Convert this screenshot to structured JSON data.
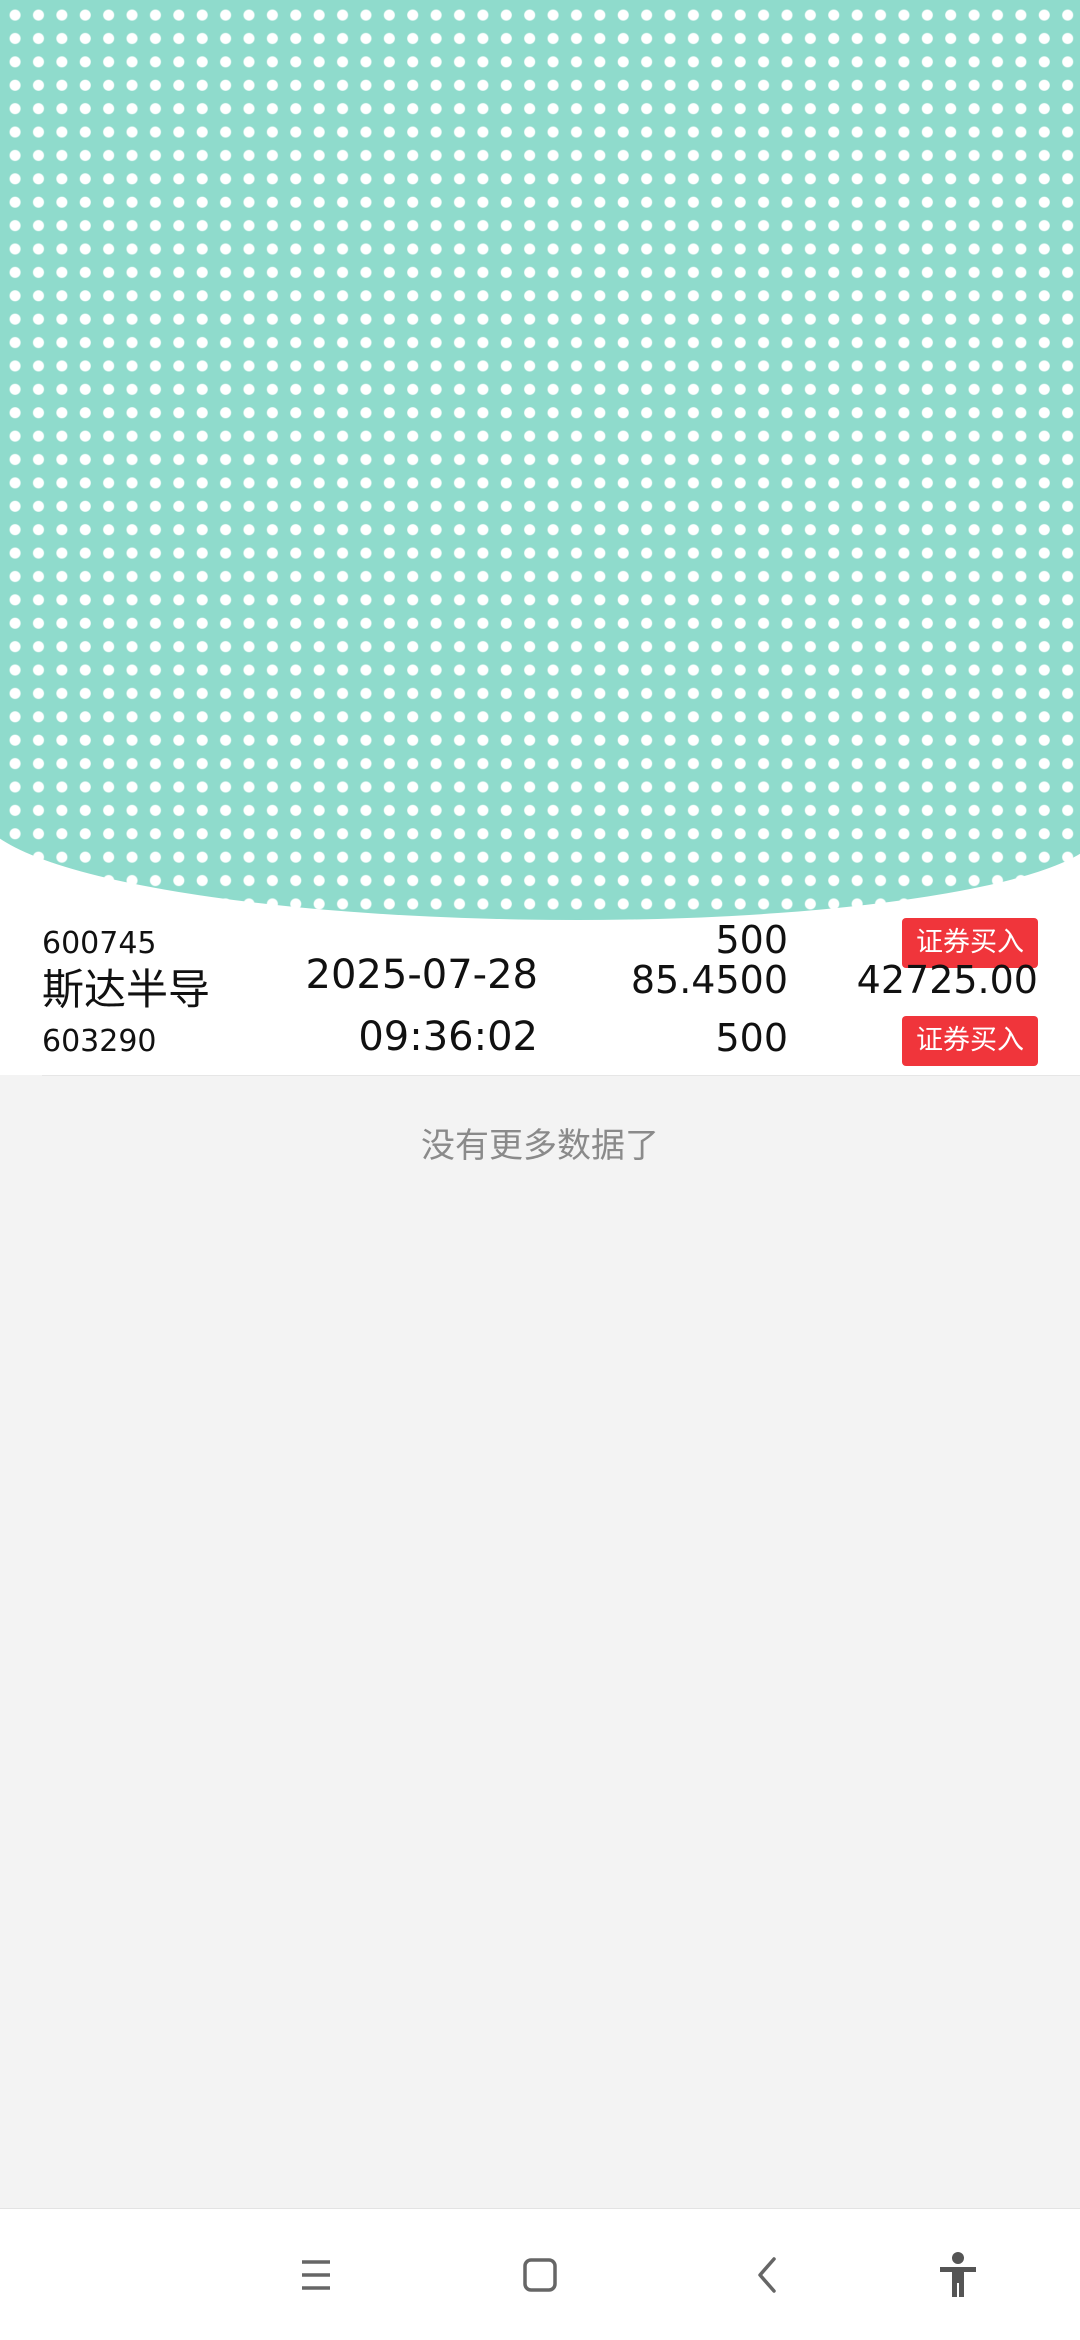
{
  "rows": [
    {
      "name": "",
      "code": "600745",
      "date": "",
      "time": "",
      "price": "",
      "qty": "500",
      "amount": "",
      "tag": "证券买入"
    },
    {
      "name": "斯达半导",
      "code": "603290",
      "date": "2025-07-28",
      "time": "09:36:02",
      "price": "85.4500",
      "qty": "500",
      "amount": "42725.00",
      "tag": "证券买入"
    }
  ],
  "footer": {
    "no_more": "没有更多数据了"
  },
  "navbar": {
    "icons": [
      "menu-icon",
      "home-icon",
      "back-icon",
      "accessibility-icon"
    ]
  },
  "colors": {
    "overlay": "#8fdbcc",
    "tag": "#f0353b",
    "page_bg": "#f3f3f3"
  }
}
